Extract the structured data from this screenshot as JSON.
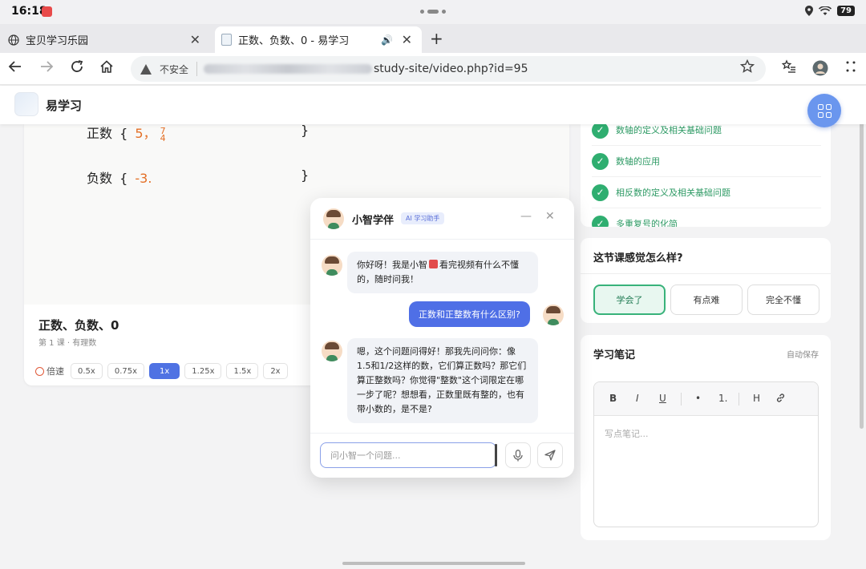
{
  "status_bar": {
    "time": "16:18",
    "battery": "79"
  },
  "tabs": [
    {
      "title": "宝贝学习乐园",
      "close": "✕"
    },
    {
      "title": "正数、负数、0 - 易学习",
      "close": "✕",
      "audio": "🔊"
    }
  ],
  "new_tab": "+",
  "address_bar": {
    "security_label": "不安全",
    "url_visible": "study-site/video.php?id=95"
  },
  "site": {
    "name": "易学习"
  },
  "video": {
    "board_line1_label": "正数",
    "board_line1_values": "5，",
    "board_line1_frac_num": "7",
    "board_line1_frac_den": "4",
    "board_line2_label": "负数",
    "board_line2_values": "-3.",
    "brace_open": "{",
    "brace_close": "}"
  },
  "lesson": {
    "title": "正数、负数、0",
    "subtitle": "第 1 课 · 有理数",
    "speed_label": "倍速",
    "speeds": [
      "0.5x",
      "0.75x",
      "1x",
      "1.25x",
      "1.5x",
      "2x"
    ],
    "active_speed": "1x"
  },
  "progress_items": [
    "数轴的定义及相关基础问题",
    "数轴的应用",
    "相反数的定义及相关基础问题",
    "多重复号的化简"
  ],
  "feedback": {
    "title": "这节课感觉怎么样?",
    "options": [
      "学会了",
      "有点难",
      "完全不懂"
    ],
    "selected": "学会了"
  },
  "notes": {
    "title": "学习笔记",
    "autosave": "自动保存",
    "toolbar": [
      "B",
      "I",
      "U",
      "•",
      "1.",
      "H",
      "🔗"
    ],
    "placeholder": "写点笔记..."
  },
  "chat": {
    "name": "小智学伴",
    "badge": "AI 学习助手",
    "minimize": "—",
    "close": "✕",
    "messages": [
      {
        "from": "ai",
        "text_a": "你好呀！我是小智",
        "text_b": "看完视频有什么不懂的，随时问我！"
      },
      {
        "from": "user",
        "text": "正数和正整数有什么区别?"
      },
      {
        "from": "ai",
        "text": "嗯，这个问题问得好！那我先问问你：像1.5和1/2这样的数，它们算正数吗？那它们算正整数吗？你觉得\"整数\"这个词限定在哪一步了呢？想想看，正数里既有整的，也有带小数的，是不是?"
      }
    ],
    "input_placeholder": "问小智一个问题..."
  },
  "colors": {
    "accent": "#4f6fe6",
    "success": "#2fae70",
    "fab": "#6a96ee",
    "board_number": "#e36f26"
  }
}
